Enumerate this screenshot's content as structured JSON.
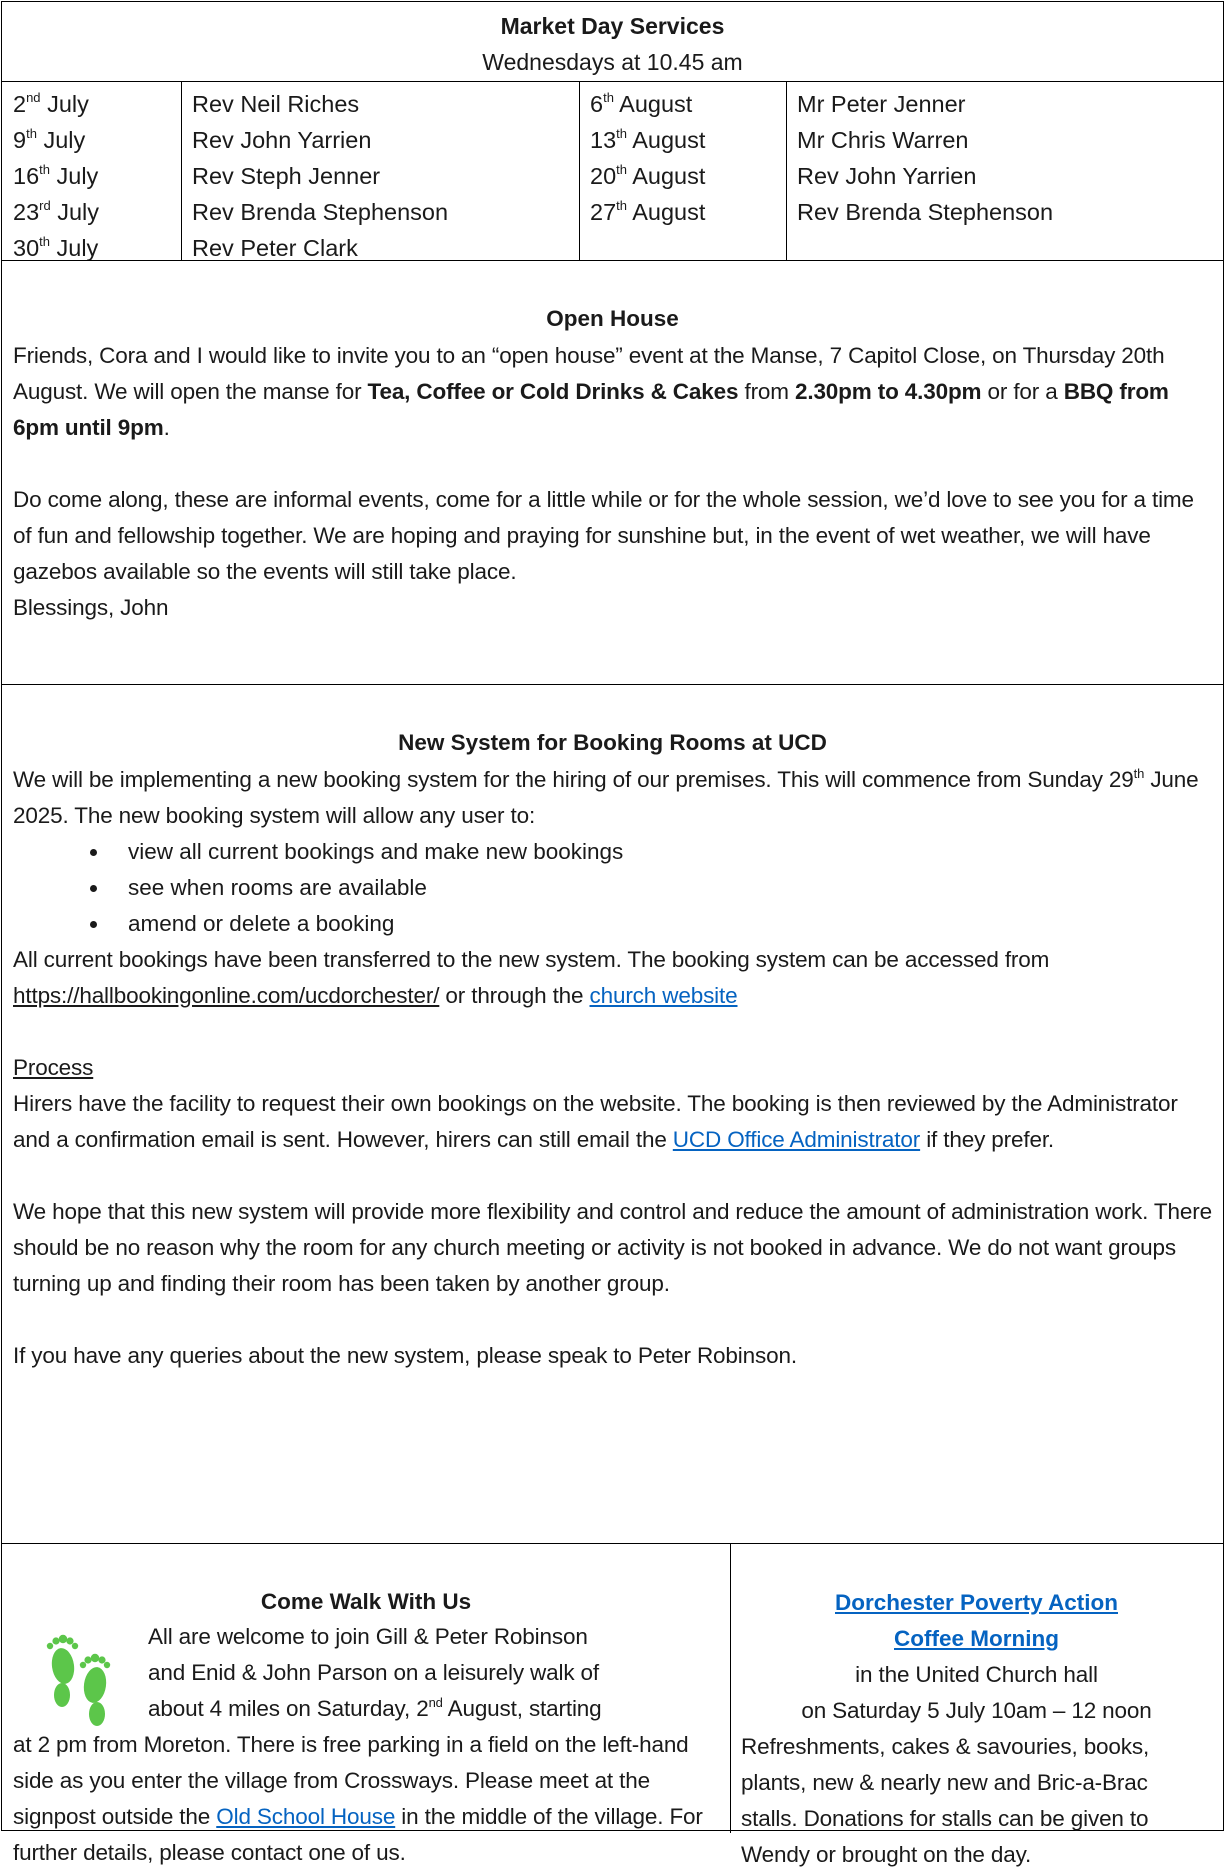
{
  "market_day": {
    "title": "Market Day Services",
    "subtitle": "Wednesdays at 10.45 am",
    "july": [
      {
        "day": "2",
        "suffix": "nd",
        "month": " July",
        "preacher": "Rev Neil Riches"
      },
      {
        "day": "9",
        "suffix": "th",
        "month": " July",
        "preacher": "Rev John Yarrien"
      },
      {
        "day": "16",
        "suffix": "th",
        "month": " July",
        "preacher": "Rev Steph Jenner"
      },
      {
        "day": "23",
        "suffix": "rd",
        "month": " July",
        "preacher": "Rev Brenda Stephenson"
      },
      {
        "day": "30",
        "suffix": "th",
        "month": " July",
        "preacher": "Rev Peter Clark"
      }
    ],
    "august": [
      {
        "day": "6",
        "suffix": "th",
        "month": " August",
        "preacher": "Mr Peter Jenner"
      },
      {
        "day": "13",
        "suffix": "th",
        "month": " August",
        "preacher": "Mr Chris Warren"
      },
      {
        "day": "20",
        "suffix": "th",
        "month": " August",
        "preacher": "Rev John Yarrien"
      },
      {
        "day": "27",
        "suffix": "th",
        "month": " August",
        "preacher": "Rev Brenda Stephenson"
      }
    ]
  },
  "open_house": {
    "title": "Open House",
    "p1_a": "Friends, Cora and I would like to invite you to an “open house” event at the Manse, 7 Capitol Close, on Thursday 20th August.  We will open the manse for ",
    "p1_b": "Tea, Coffee or Cold Drinks & Cakes",
    "p1_c": " from ",
    "p1_d": "2.30pm to 4.30pm",
    "p1_e": " or for a ",
    "p1_f": "BBQ from 6pm until 9pm",
    "p1_g": ".",
    "p2": "Do come along, these are informal events, come for a little while or for the whole session, we’d love to see you for a time of fun and fellowship together.  We are hoping and praying for sunshine but, in the event of wet weather, we will have gazebos available so the events will still take place.",
    "signoff": "Blessings, John"
  },
  "booking": {
    "title": "New System for Booking Rooms at UCD",
    "intro_a": "We will be implementing a new booking system for the hiring of our premises.  This will commence from Sunday 29",
    "intro_sup": "th",
    "intro_b": " June 2025.  The new booking system will allow any user to:",
    "bullets": [
      "view all current bookings and make new bookings",
      "see when rooms are available",
      "amend or delete a booking"
    ],
    "transfer_a": "All current bookings have been transferred to the new system.  The booking system can be accessed from ",
    "url": "https://hallbookingonline.com/ucdorchester/",
    "transfer_b": " or through the ",
    "website_link": "church website",
    "process_heading": "Process",
    "process_a": "Hirers have the facility to request their own bookings on the website.  The booking is then reviewed by the Administrator and a confirmation email is sent.  However, hirers can still email the ",
    "admin_link": "UCD Office Administrator",
    "process_b": " if they prefer.",
    "hope": "We hope that this new system will provide more flexibility and control and reduce the amount of administration work.  There should be no reason why the room for any church meeting or activity is not booked in advance.  We do not want groups turning up and finding their room has been taken by another group.",
    "queries": "If you have any queries about the new system, please speak to Peter Robinson."
  },
  "walk": {
    "title": "Come Walk With Us",
    "icon": "footprints-icon",
    "icon_color": "#5cc64a",
    "line1": "All are welcome to join Gill & Peter Robinson",
    "line2": "and Enid & John Parson on a leisurely walk of",
    "line3_a": "about 4 miles on Saturday, 2",
    "line3_sup": "nd",
    "line3_b": " August, starting",
    "rest_a": "at 2 pm from Moreton.  There is free parking in a field on the left-hand side as you enter the village from Crossways.  Please meet at the signpost outside the ",
    "old_school_link": "Old School House",
    "rest_b": " in the middle of the village.  For further details, please contact one of us."
  },
  "coffee": {
    "title_link_1": "Dorchester Poverty Action",
    "title_link_2": "Coffee Morning",
    "line1": "in the United Church hall",
    "line2": "on Saturday 5 July 10am – 12 noon",
    "body": "Refreshments, cakes & savouries, books, plants, new & nearly new and Bric-a-Brac stalls.  Donations for stalls can be given to Wendy or brought on the day."
  }
}
